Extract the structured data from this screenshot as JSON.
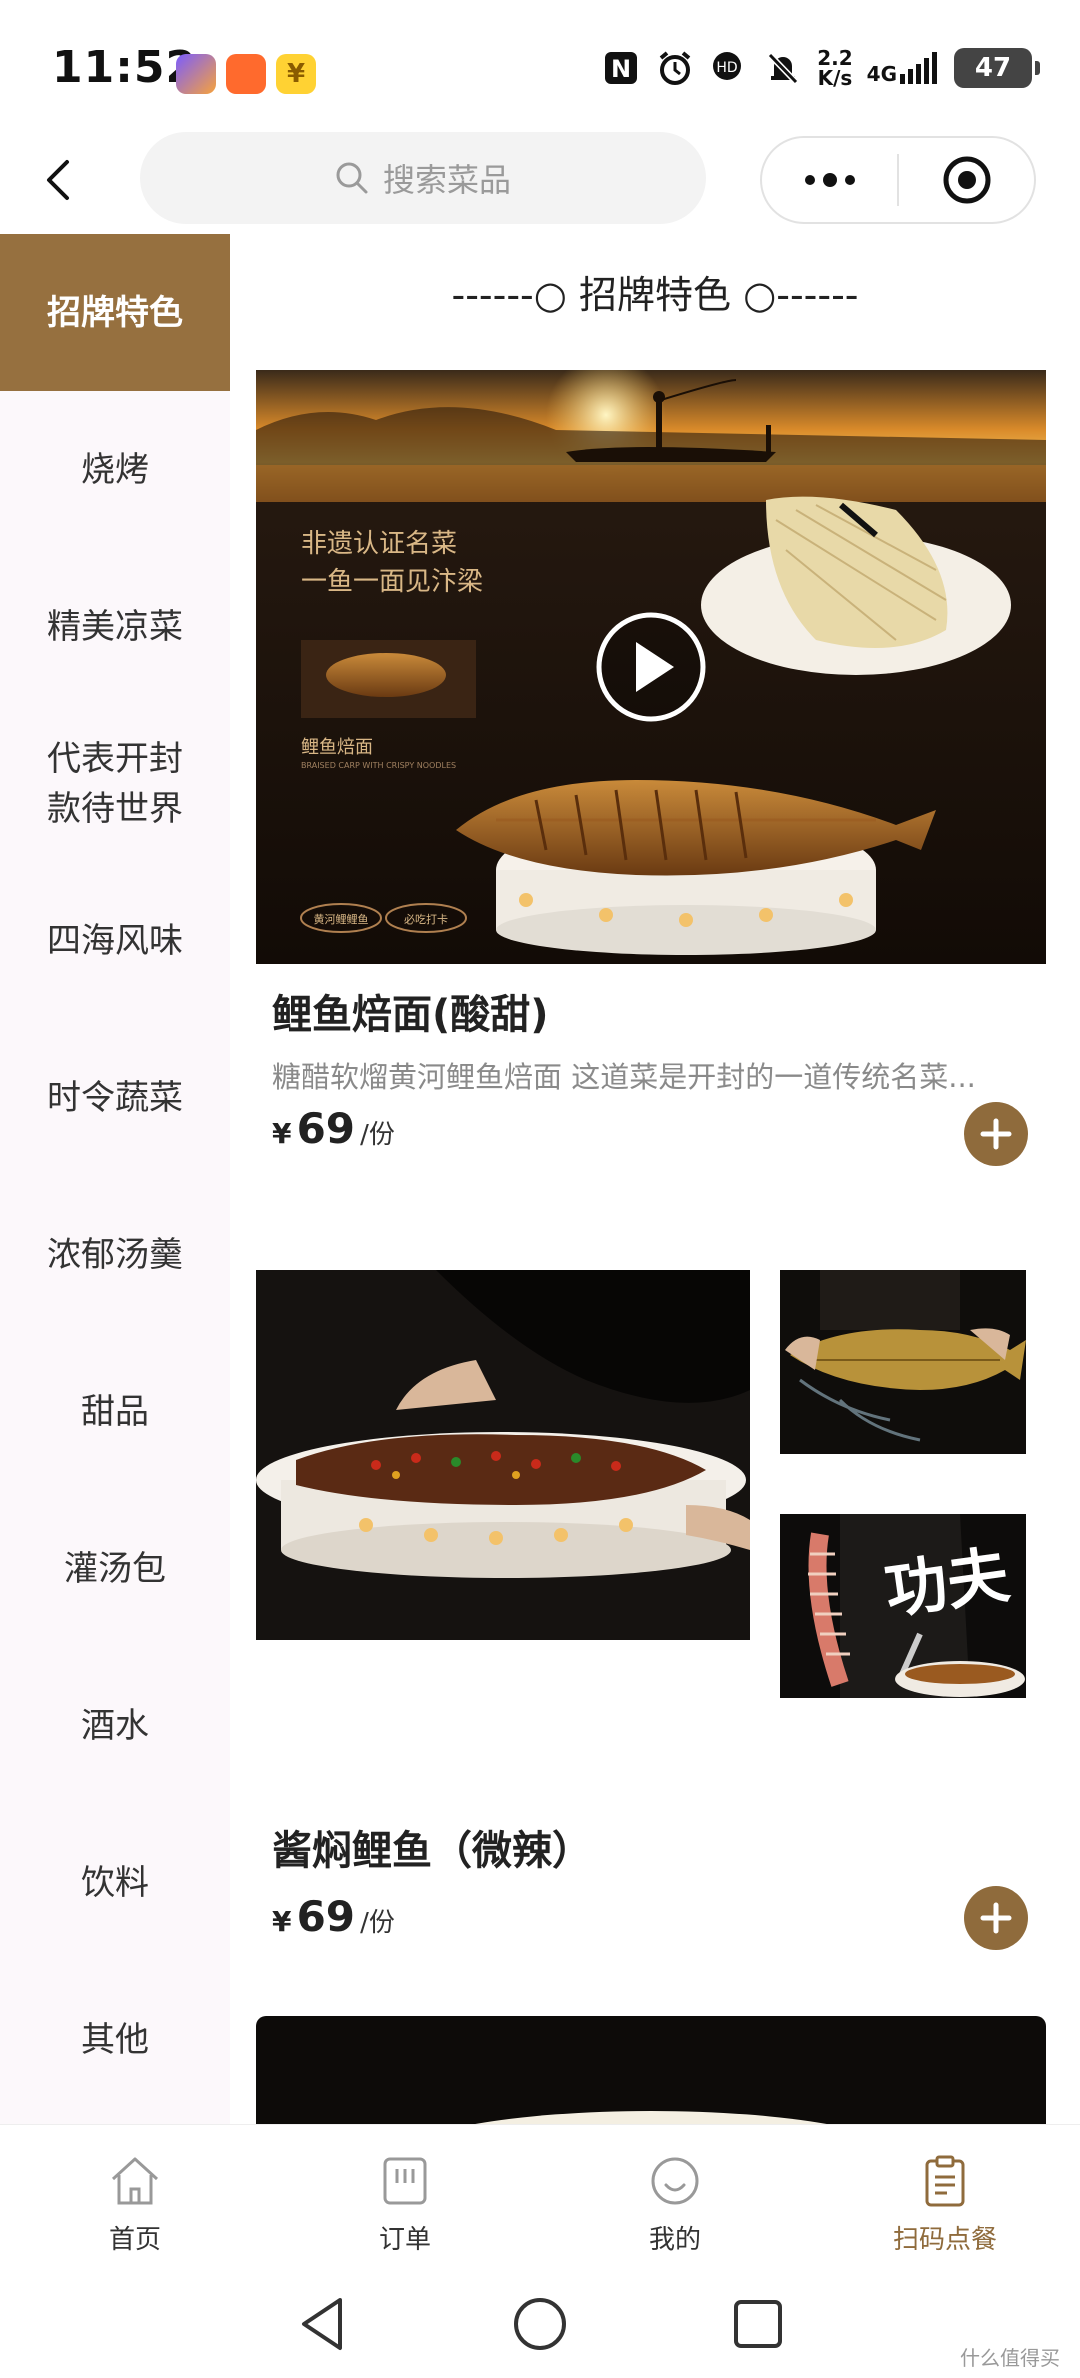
{
  "status_bar": {
    "time": "11:52",
    "net_speed_value": "2.2",
    "net_speed_unit": "K/s",
    "network": "4G",
    "battery": "47"
  },
  "header": {
    "search_placeholder": "搜索菜品"
  },
  "sidebar": {
    "items": [
      {
        "label": "招牌特色"
      },
      {
        "label": "烧烤"
      },
      {
        "label": "精美凉菜"
      },
      {
        "label": "代表开封\n款待世界"
      },
      {
        "label": "四海风味"
      },
      {
        "label": "时令蔬菜"
      },
      {
        "label": "浓郁汤羹"
      },
      {
        "label": "甜品"
      },
      {
        "label": "灌汤包"
      },
      {
        "label": "酒水"
      },
      {
        "label": "饮料"
      },
      {
        "label": "其他"
      }
    ]
  },
  "main": {
    "section_title": "------○ 招牌特色 ○------",
    "dishes": [
      {
        "name": "鲤鱼焙面(酸甜)",
        "description": "糖醋软熘黄河鲤鱼焙面 这道菜是开封的一道传统名菜...",
        "currency": "¥",
        "price": "69",
        "unit": "/份",
        "image_text": {
          "headline_1": "非遗认证名菜",
          "headline_2": "一鱼一面见汴梁",
          "dish_label": "鲤鱼焙面",
          "dish_label_en": "BRAISED CARP WITH CRISPY NOODLES",
          "badge_1": "黄河鲤鲤鱼",
          "badge_2": "必吃打卡"
        }
      },
      {
        "name": "酱焖鲤鱼（微辣）",
        "currency": "¥",
        "price": "69",
        "unit": "/份",
        "image_text": {
          "brush_text": "功夫"
        }
      }
    ]
  },
  "tabbar": {
    "tabs": [
      {
        "label": "首页"
      },
      {
        "label": "订单"
      },
      {
        "label": "我的"
      },
      {
        "label": "扫码点餐"
      }
    ]
  },
  "watermark": "什么值得买",
  "colors": {
    "accent": "#96703f",
    "sidebar_bg": "#fcf8fb"
  }
}
